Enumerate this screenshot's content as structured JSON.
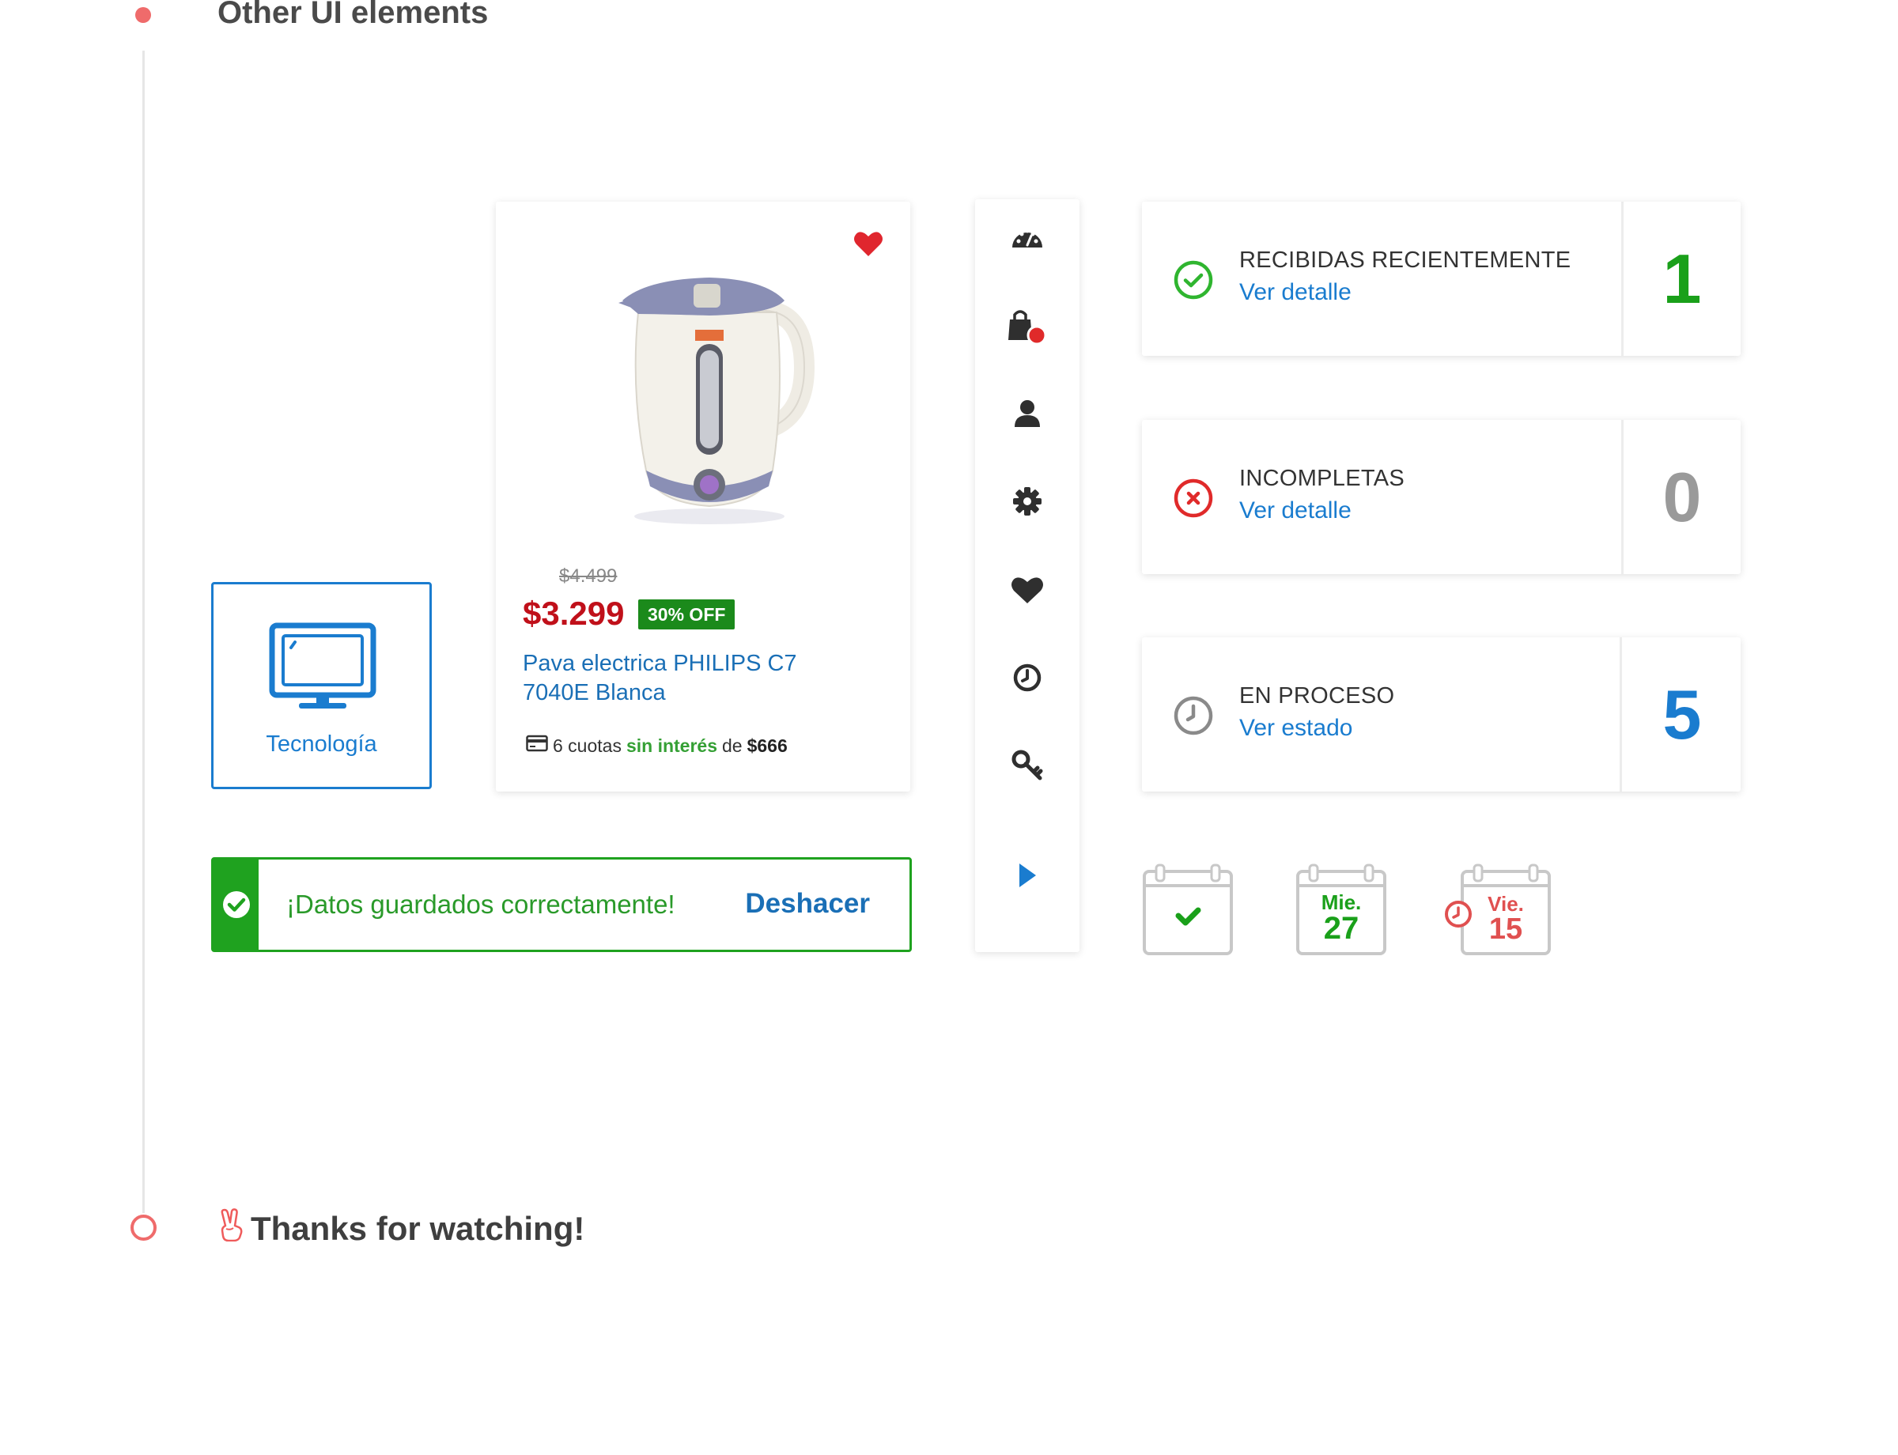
{
  "section": {
    "title": "Other UI elements"
  },
  "footer": {
    "thanks": "Thanks for watching!"
  },
  "category": {
    "label": "Tecnología",
    "icon": "monitor-icon"
  },
  "product": {
    "old_price": "$4.499",
    "price": "$3.299",
    "badge": "30% OFF",
    "name": "Pava electrica PHILIPS C7 7040E Blanca",
    "installments": {
      "count_text": "6 cuotas",
      "interest": "sin interés",
      "of": "de",
      "amount": "$666"
    }
  },
  "toast": {
    "message": "¡Datos guardados correctamente!",
    "undo": "Deshacer"
  },
  "iconbar": {
    "items": [
      "dashboard-icon",
      "shopping-bag-icon",
      "user-icon",
      "gear-icon",
      "heart-icon",
      "clock-icon",
      "key-icon",
      "play-arrow-icon"
    ]
  },
  "status_cards": [
    {
      "title": "RECIBIDAS RECIENTEMENTE",
      "link": "Ver detalle",
      "count": "1",
      "color": "#1aa01a"
    },
    {
      "title": "INCOMPLETAS",
      "link": "Ver detalle",
      "count": "0",
      "color": "#9a9a9a"
    },
    {
      "title": "EN PROCESO",
      "link": "Ver estado",
      "count": "5",
      "color": "#1a7ccf"
    }
  ],
  "calendars": [
    {
      "icon": "calendar-check-icon"
    },
    {
      "day": "Mie.",
      "date": "27",
      "color": "#1aa01a"
    },
    {
      "day": "Vie.",
      "date": "15",
      "color": "#e05050"
    }
  ],
  "colors": {
    "accent": "#1a7ccf",
    "success": "#1fa21f",
    "danger": "#c0101a",
    "timeline": "#ef6b6b"
  }
}
